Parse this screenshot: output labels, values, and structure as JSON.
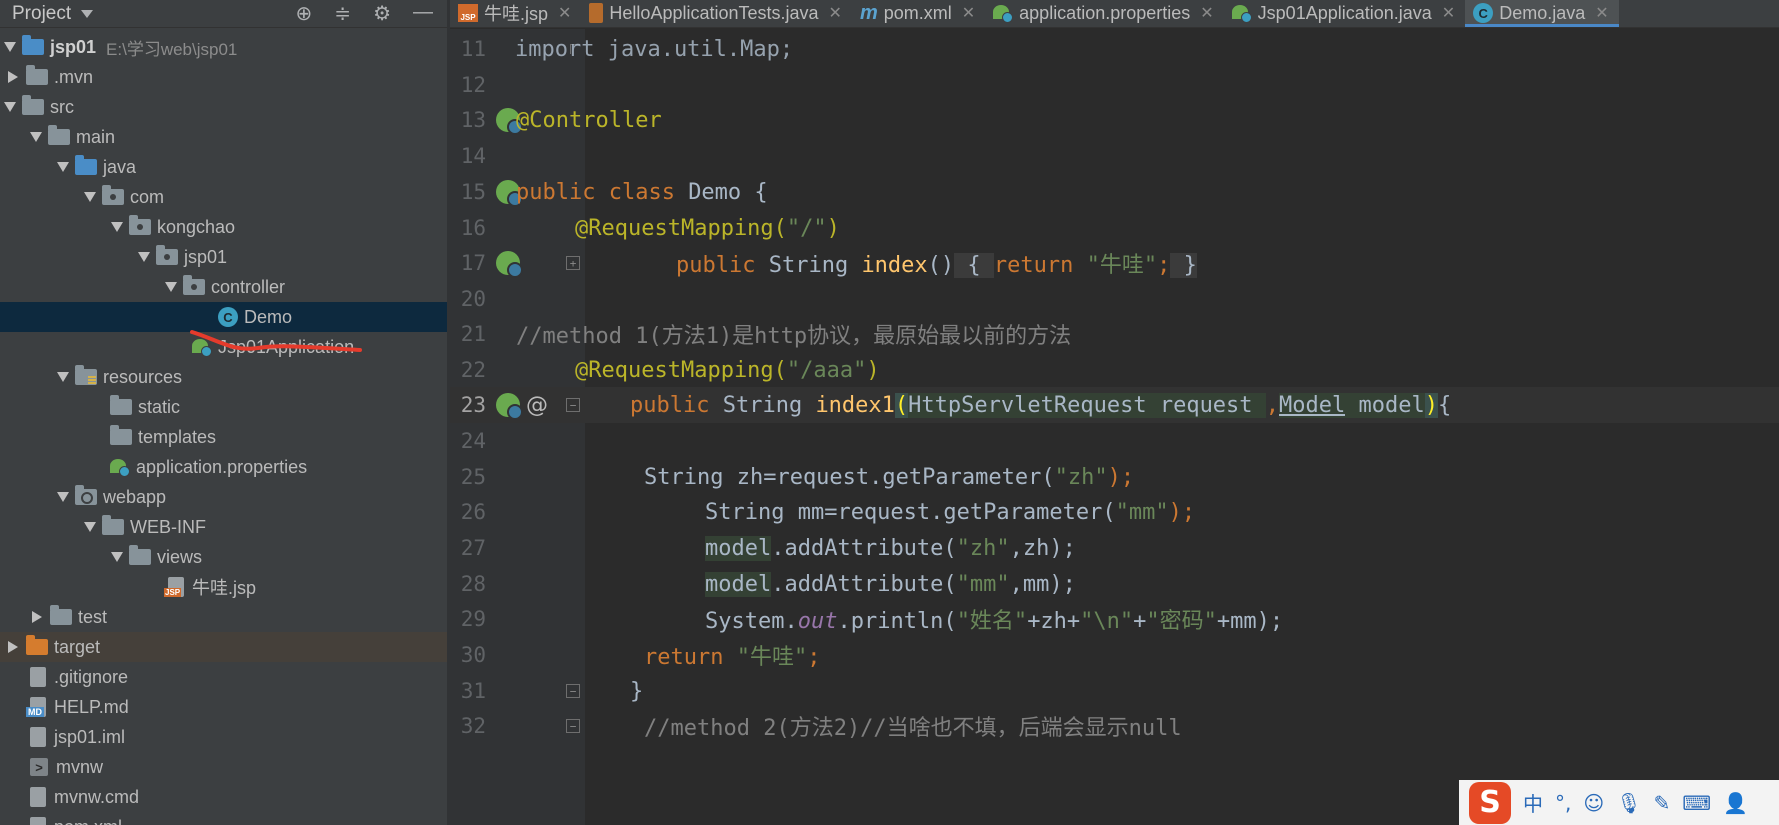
{
  "project": {
    "title": "Project",
    "tree": [
      {
        "label": "jsp01",
        "extra": "E:\\学习web\\jsp01"
      },
      {
        "label": ".mvn"
      },
      {
        "label": "src"
      },
      {
        "label": "main"
      },
      {
        "label": "java"
      },
      {
        "label": "com"
      },
      {
        "label": "kongchao"
      },
      {
        "label": "jsp01"
      },
      {
        "label": "controller"
      },
      {
        "label": "Demo"
      },
      {
        "label": "Jsp01Application"
      },
      {
        "label": "resources"
      },
      {
        "label": "static"
      },
      {
        "label": "templates"
      },
      {
        "label": "application.properties"
      },
      {
        "label": "webapp"
      },
      {
        "label": "WEB-INF"
      },
      {
        "label": "views"
      },
      {
        "label": "牛哇.jsp"
      },
      {
        "label": "test"
      },
      {
        "label": "target"
      },
      {
        "label": ".gitignore"
      },
      {
        "label": "HELP.md"
      },
      {
        "label": "jsp01.iml"
      },
      {
        "label": "mvnw"
      },
      {
        "label": "mvnw.cmd"
      },
      {
        "label": "pom.xml"
      }
    ]
  },
  "tabs": [
    {
      "label": "牛哇.jsp",
      "icon": "jsp-file-icon"
    },
    {
      "label": "HelloApplicationTests.java",
      "icon": "java-file-icon"
    },
    {
      "label": "pom.xml",
      "icon": "maven-icon"
    },
    {
      "label": "application.properties",
      "icon": "spring-icon"
    },
    {
      "label": "Jsp01Application.java",
      "icon": "spring-boot-icon"
    },
    {
      "label": "Demo.java",
      "icon": "class-icon",
      "active": true
    }
  ],
  "editor": {
    "line_numbers": [
      "11",
      "12",
      "13",
      "14",
      "15",
      "16",
      "17",
      "20",
      "21",
      "22",
      "23",
      "24",
      "25",
      "26",
      "27",
      "28",
      "29",
      "30",
      "31",
      "32"
    ],
    "text": {
      "l11": "import java.util.Map;",
      "l13": "@Controller",
      "l15_kw": "public class ",
      "l15_name": "Demo {",
      "l16_an": "@RequestMapping(",
      "l16_str": "\"/\"",
      "l16_end": ")",
      "l17_kw": "public ",
      "l17_type": "String ",
      "l17_fn": "index",
      "l17_paren": "()",
      "l17_open": " { ",
      "l17_ret": "return ",
      "l17_str": "\"牛哇\"",
      "l17_semi": ";",
      "l17_close": " }",
      "l21": "//method 1(方法1)是http协议，最原始最以前的方法",
      "l22_an": "@RequestMapping(",
      "l22_str": "\"/aaa\"",
      "l22_end": ")",
      "l23_kw": "public ",
      "l23_type": "String ",
      "l23_fn": "index1",
      "l23_p1": "(",
      "l23_args1": "HttpServletRequest request ",
      "l23_comma": ",",
      "l23_model": "Model",
      "l23_args2": " model",
      "l23_p2": ")",
      "l23_brace": "{",
      "l25_a": "String zh=request.getParameter(",
      "l25_str": "\"zh\"",
      "l25_b": ");",
      "l26_a": "String mm=request.getParameter(",
      "l26_str": "\"mm\"",
      "l26_b": ");",
      "l27_a": "model",
      "l27_b": ".addAttribute(",
      "l27_str": "\"zh\"",
      "l27_c": ",zh);",
      "l28_a": "model",
      "l28_b": ".addAttribute(",
      "l28_str": "\"mm\"",
      "l28_c": ",mm);",
      "l29_a": "System.",
      "l29_out": "out",
      "l29_b": ".println(",
      "l29_s1": "\"姓名\"",
      "l29_c": "+zh+",
      "l29_s2": "\"\\n\"",
      "l29_d": "+",
      "l29_s3": "\"密码\"",
      "l29_e": "+mm);",
      "l30_kw": "return ",
      "l30_str": "\"牛哇\"",
      "l30_semi": ";",
      "l31": "}",
      "l32": "//method 2(方法2)//当啥也不填，后端会显示null"
    }
  },
  "ime": {
    "logo": "S",
    "lang": "中"
  },
  "colors": {
    "background": "#2b2b2b",
    "panel": "#3c3f41",
    "selection": "#0d293e",
    "keyword": "#cc7832",
    "annotation": "#bbb529",
    "string": "#6a8759",
    "function": "#ffc66d",
    "accent": "#4a88c7"
  }
}
